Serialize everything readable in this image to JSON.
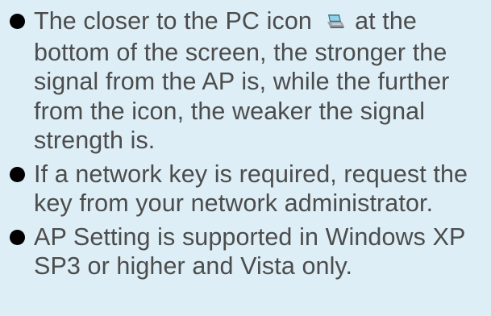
{
  "notes": [
    {
      "text_before_icon": "The closer to the PC icon ",
      "icon": "pc-icon",
      "text_after_icon": " at the bottom of the screen, the stronger the signal from the AP is, while the further from the icon, the weaker the signal strength is."
    },
    {
      "text": "If a network key is required, request the key from your network administrator."
    },
    {
      "text": "AP Setting is supported in Windows XP SP3 or higher and Vista only."
    }
  ],
  "colors": {
    "background": "#ddeef6",
    "text": "#4c4c4c",
    "bullet": "#000000"
  }
}
